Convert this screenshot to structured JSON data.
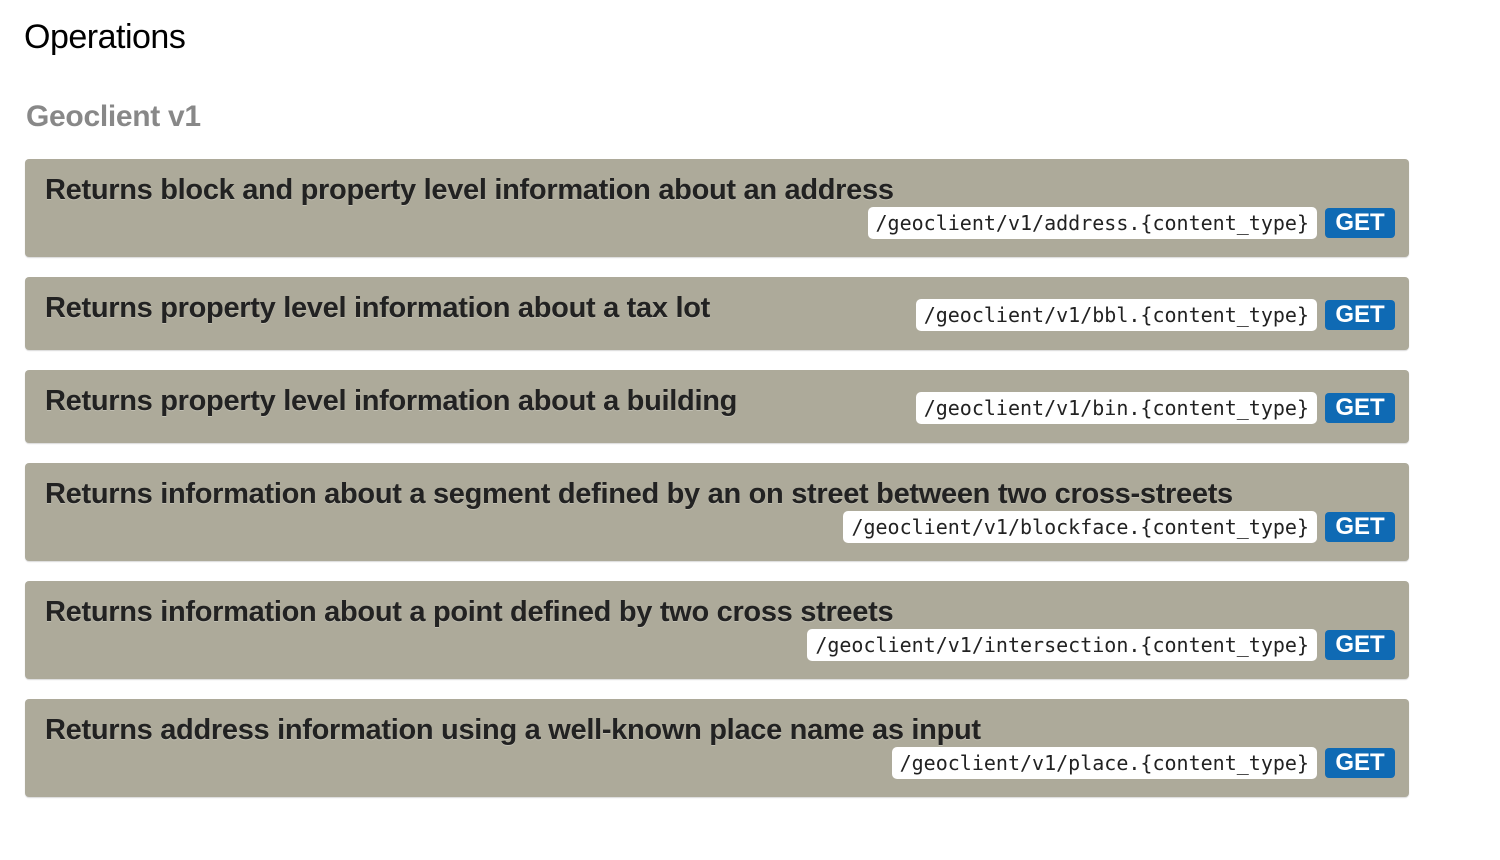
{
  "page": {
    "title": "Operations"
  },
  "section": {
    "title": "Geoclient v1"
  },
  "operations": [
    {
      "summary": "Returns block and property level information about an address",
      "path": "/geoclient/v1/address.{content_type}",
      "method": "GET"
    },
    {
      "summary": "Returns property level information about a tax lot",
      "path": "/geoclient/v1/bbl.{content_type}",
      "method": "GET"
    },
    {
      "summary": "Returns property level information about a building",
      "path": "/geoclient/v1/bin.{content_type}",
      "method": "GET"
    },
    {
      "summary": "Returns information about a segment defined by an on street between two cross-streets",
      "path": "/geoclient/v1/blockface.{content_type}",
      "method": "GET"
    },
    {
      "summary": "Returns information about a point defined by two cross streets",
      "path": "/geoclient/v1/intersection.{content_type}",
      "method": "GET"
    },
    {
      "summary": "Returns address information using a well-known place name as input",
      "path": "/geoclient/v1/place.{content_type}",
      "method": "GET"
    }
  ],
  "colors": {
    "operation_background": "#adaa9a",
    "get_badge": "#0f6ab4",
    "section_title": "#888888"
  }
}
